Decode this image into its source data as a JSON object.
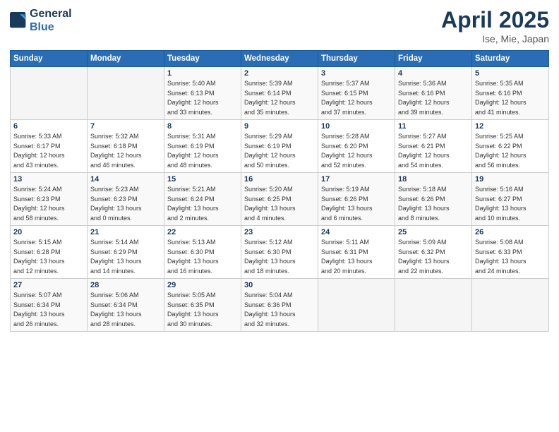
{
  "header": {
    "logo_line1": "General",
    "logo_line2": "Blue",
    "month_title": "April 2025",
    "location": "Ise, Mie, Japan"
  },
  "weekdays": [
    "Sunday",
    "Monday",
    "Tuesday",
    "Wednesday",
    "Thursday",
    "Friday",
    "Saturday"
  ],
  "weeks": [
    [
      {
        "day": "",
        "info": ""
      },
      {
        "day": "",
        "info": ""
      },
      {
        "day": "1",
        "info": "Sunrise: 5:40 AM\nSunset: 6:13 PM\nDaylight: 12 hours\nand 33 minutes."
      },
      {
        "day": "2",
        "info": "Sunrise: 5:39 AM\nSunset: 6:14 PM\nDaylight: 12 hours\nand 35 minutes."
      },
      {
        "day": "3",
        "info": "Sunrise: 5:37 AM\nSunset: 6:15 PM\nDaylight: 12 hours\nand 37 minutes."
      },
      {
        "day": "4",
        "info": "Sunrise: 5:36 AM\nSunset: 6:16 PM\nDaylight: 12 hours\nand 39 minutes."
      },
      {
        "day": "5",
        "info": "Sunrise: 5:35 AM\nSunset: 6:16 PM\nDaylight: 12 hours\nand 41 minutes."
      }
    ],
    [
      {
        "day": "6",
        "info": "Sunrise: 5:33 AM\nSunset: 6:17 PM\nDaylight: 12 hours\nand 43 minutes."
      },
      {
        "day": "7",
        "info": "Sunrise: 5:32 AM\nSunset: 6:18 PM\nDaylight: 12 hours\nand 46 minutes."
      },
      {
        "day": "8",
        "info": "Sunrise: 5:31 AM\nSunset: 6:19 PM\nDaylight: 12 hours\nand 48 minutes."
      },
      {
        "day": "9",
        "info": "Sunrise: 5:29 AM\nSunset: 6:19 PM\nDaylight: 12 hours\nand 50 minutes."
      },
      {
        "day": "10",
        "info": "Sunrise: 5:28 AM\nSunset: 6:20 PM\nDaylight: 12 hours\nand 52 minutes."
      },
      {
        "day": "11",
        "info": "Sunrise: 5:27 AM\nSunset: 6:21 PM\nDaylight: 12 hours\nand 54 minutes."
      },
      {
        "day": "12",
        "info": "Sunrise: 5:25 AM\nSunset: 6:22 PM\nDaylight: 12 hours\nand 56 minutes."
      }
    ],
    [
      {
        "day": "13",
        "info": "Sunrise: 5:24 AM\nSunset: 6:23 PM\nDaylight: 12 hours\nand 58 minutes."
      },
      {
        "day": "14",
        "info": "Sunrise: 5:23 AM\nSunset: 6:23 PM\nDaylight: 13 hours\nand 0 minutes."
      },
      {
        "day": "15",
        "info": "Sunrise: 5:21 AM\nSunset: 6:24 PM\nDaylight: 13 hours\nand 2 minutes."
      },
      {
        "day": "16",
        "info": "Sunrise: 5:20 AM\nSunset: 6:25 PM\nDaylight: 13 hours\nand 4 minutes."
      },
      {
        "day": "17",
        "info": "Sunrise: 5:19 AM\nSunset: 6:26 PM\nDaylight: 13 hours\nand 6 minutes."
      },
      {
        "day": "18",
        "info": "Sunrise: 5:18 AM\nSunset: 6:26 PM\nDaylight: 13 hours\nand 8 minutes."
      },
      {
        "day": "19",
        "info": "Sunrise: 5:16 AM\nSunset: 6:27 PM\nDaylight: 13 hours\nand 10 minutes."
      }
    ],
    [
      {
        "day": "20",
        "info": "Sunrise: 5:15 AM\nSunset: 6:28 PM\nDaylight: 13 hours\nand 12 minutes."
      },
      {
        "day": "21",
        "info": "Sunrise: 5:14 AM\nSunset: 6:29 PM\nDaylight: 13 hours\nand 14 minutes."
      },
      {
        "day": "22",
        "info": "Sunrise: 5:13 AM\nSunset: 6:30 PM\nDaylight: 13 hours\nand 16 minutes."
      },
      {
        "day": "23",
        "info": "Sunrise: 5:12 AM\nSunset: 6:30 PM\nDaylight: 13 hours\nand 18 minutes."
      },
      {
        "day": "24",
        "info": "Sunrise: 5:11 AM\nSunset: 6:31 PM\nDaylight: 13 hours\nand 20 minutes."
      },
      {
        "day": "25",
        "info": "Sunrise: 5:09 AM\nSunset: 6:32 PM\nDaylight: 13 hours\nand 22 minutes."
      },
      {
        "day": "26",
        "info": "Sunrise: 5:08 AM\nSunset: 6:33 PM\nDaylight: 13 hours\nand 24 minutes."
      }
    ],
    [
      {
        "day": "27",
        "info": "Sunrise: 5:07 AM\nSunset: 6:34 PM\nDaylight: 13 hours\nand 26 minutes."
      },
      {
        "day": "28",
        "info": "Sunrise: 5:06 AM\nSunset: 6:34 PM\nDaylight: 13 hours\nand 28 minutes."
      },
      {
        "day": "29",
        "info": "Sunrise: 5:05 AM\nSunset: 6:35 PM\nDaylight: 13 hours\nand 30 minutes."
      },
      {
        "day": "30",
        "info": "Sunrise: 5:04 AM\nSunset: 6:36 PM\nDaylight: 13 hours\nand 32 minutes."
      },
      {
        "day": "",
        "info": ""
      },
      {
        "day": "",
        "info": ""
      },
      {
        "day": "",
        "info": ""
      }
    ]
  ]
}
